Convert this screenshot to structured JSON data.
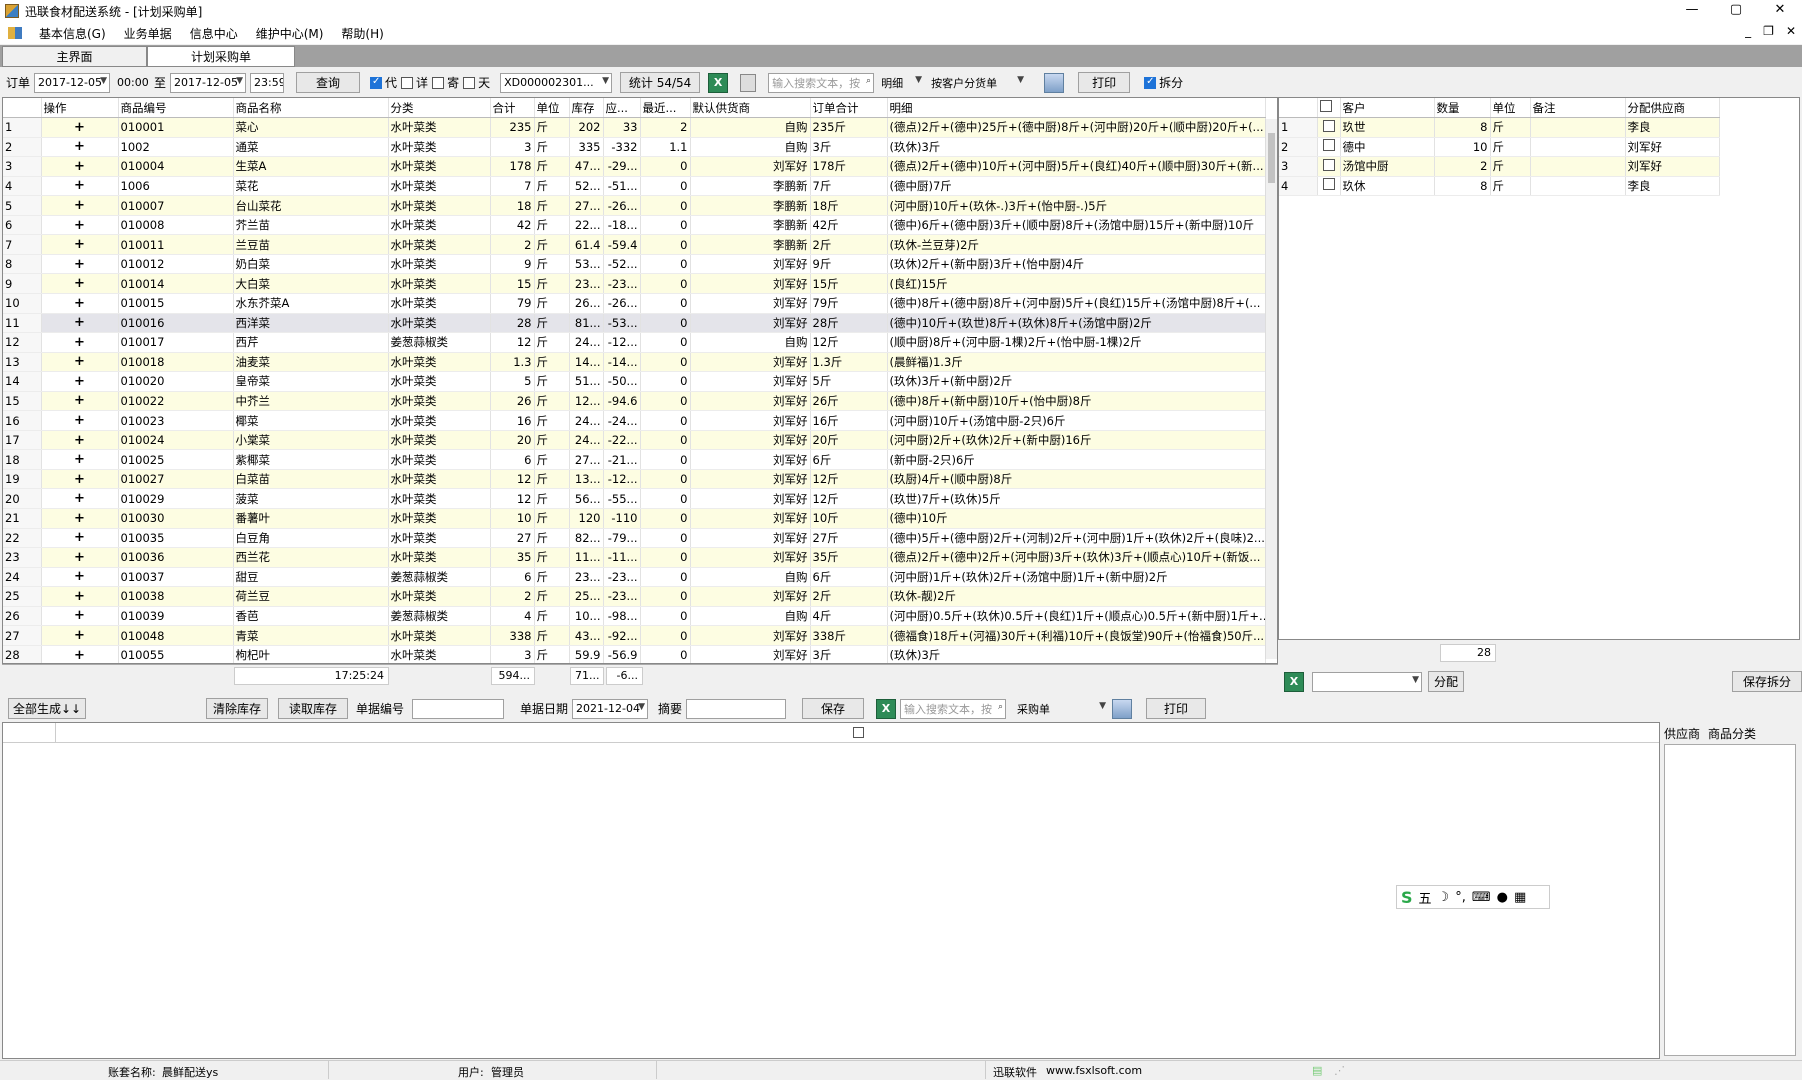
{
  "window": {
    "title": "迅联食材配送系统 - [计划采购单]",
    "min": "—",
    "max": "▢",
    "close": "✕"
  },
  "menu": [
    "基本信息(G)",
    "业务单据",
    "信息中心",
    "维护中心(M)",
    "帮助(H)"
  ],
  "tabs": [
    "主界面",
    "计划采购单"
  ],
  "toolbar": {
    "order_label": "订单",
    "date_from": "2017-12-05",
    "time_from": "00:00",
    "to_label": "至",
    "date_to": "2017-12-05",
    "time_to": "23:59",
    "query": "查询",
    "chk_dai": "代",
    "chk_xiang": "详",
    "chk_ji": "寄",
    "chk_tian": "天",
    "order_no": "XD000002301...",
    "stats": "统计 54/54",
    "search_placeholder": "输入搜索文本，按",
    "detail_select": "明细",
    "group_select": "按客户分货单",
    "print": "打印",
    "split": "拆分"
  },
  "main_table": {
    "headers": [
      "操作",
      "商品编号",
      "商品名称",
      "分类",
      "合计",
      "单位",
      "库存",
      "应...",
      "最近...",
      "默认供货商",
      "订单合计",
      "明细"
    ],
    "rows": [
      [
        "1",
        "+",
        "010001",
        "菜心",
        "水叶菜类",
        "235",
        "斤",
        "202",
        "33",
        "2",
        "自购",
        "235斤",
        "(德点)2斤+(德中)25斤+(德中厨)8斤+(河中厨)20斤+(顺中厨)20斤+(..."
      ],
      [
        "2",
        "+",
        "1002",
        "通菜",
        "水叶菜类",
        "3",
        "斤",
        "335",
        "-332",
        "1.1",
        "自购",
        "3斤",
        "(玖休)3斤"
      ],
      [
        "3",
        "+",
        "010004",
        "生菜A",
        "水叶菜类",
        "178",
        "斤",
        "47...",
        "-29...",
        "0",
        "刘军好",
        "178斤",
        "(德点)2斤+(德中)10斤+(河中厨)5斤+(良红)40斤+(顺中厨)30斤+(新..."
      ],
      [
        "4",
        "+",
        "1006",
        "菜花",
        "水叶菜类",
        "7",
        "斤",
        "52...",
        "-51...",
        "0",
        "李鹏新",
        "7斤",
        "(德中厨)7斤"
      ],
      [
        "5",
        "+",
        "010007",
        "台山菜花",
        "水叶菜类",
        "18",
        "斤",
        "27...",
        "-26...",
        "0",
        "李鹏新",
        "18斤",
        "(河中厨)10斤+(玖休-.)3斤+(怡中厨-.)5斤"
      ],
      [
        "6",
        "+",
        "010008",
        "芥兰苗",
        "水叶菜类",
        "42",
        "斤",
        "22...",
        "-18...",
        "0",
        "李鹏新",
        "42斤",
        "(德中)6斤+(德中厨)3斤+(顺中厨)8斤+(汤馆中厨)15斤+(新中厨)10斤"
      ],
      [
        "7",
        "+",
        "010011",
        "兰豆苗",
        "水叶菜类",
        "2",
        "斤",
        "61.4",
        "-59.4",
        "0",
        "李鹏新",
        "2斤",
        "(玖休-兰豆芽)2斤"
      ],
      [
        "8",
        "+",
        "010012",
        "奶白菜",
        "水叶菜类",
        "9",
        "斤",
        "53...",
        "-52...",
        "0",
        "刘军好",
        "9斤",
        "(玖休)2斤+(新中厨)3斤+(怡中厨)4斤"
      ],
      [
        "9",
        "+",
        "010014",
        "大白菜",
        "水叶菜类",
        "15",
        "斤",
        "23...",
        "-23...",
        "0",
        "刘军好",
        "15斤",
        "(良红)15斤"
      ],
      [
        "10",
        "+",
        "010015",
        "水东芥菜A",
        "水叶菜类",
        "79",
        "斤",
        "26...",
        "-26...",
        "0",
        "刘军好",
        "79斤",
        "(德中)8斤+(德中厨)8斤+(河中厨)5斤+(良红)15斤+(汤馆中厨)8斤+(..."
      ],
      [
        "11",
        "+",
        "010016",
        "西洋菜",
        "水叶菜类",
        "28",
        "斤",
        "81...",
        "-53...",
        "0",
        "刘军好",
        "28斤",
        "(德中)10斤+(玖世)8斤+(玖休)8斤+(汤馆中厨)2斤"
      ],
      [
        "12",
        "+",
        "010017",
        "西芹",
        "姜葱蒜椒类",
        "12",
        "斤",
        "24...",
        "-12...",
        "0",
        "自购",
        "12斤",
        "(顺中厨)8斤+(河中厨-1棵)2斤+(怡中厨-1棵)2斤"
      ],
      [
        "13",
        "+",
        "010018",
        "油麦菜",
        "水叶菜类",
        "1.3",
        "斤",
        "14...",
        "-14...",
        "0",
        "刘军好",
        "1.3斤",
        "(晨鲜福)1.3斤"
      ],
      [
        "14",
        "+",
        "010020",
        "皇帝菜",
        "水叶菜类",
        "5",
        "斤",
        "51...",
        "-50...",
        "0",
        "刘军好",
        "5斤",
        "(玖休)3斤+(新中厨)2斤"
      ],
      [
        "15",
        "+",
        "010022",
        "中芥兰",
        "水叶菜类",
        "26",
        "斤",
        "12...",
        "-94.6",
        "0",
        "刘军好",
        "26斤",
        "(德中)8斤+(新中厨)10斤+(怡中厨)8斤"
      ],
      [
        "16",
        "+",
        "010023",
        "椰菜",
        "水叶菜类",
        "16",
        "斤",
        "24...",
        "-24...",
        "0",
        "刘军好",
        "16斤",
        "(河中厨)10斤+(汤馆中厨-2只)6斤"
      ],
      [
        "17",
        "+",
        "010024",
        "小棠菜",
        "水叶菜类",
        "20",
        "斤",
        "24...",
        "-22...",
        "0",
        "刘军好",
        "20斤",
        "(河中厨)2斤+(玖休)2斤+(新中厨)16斤"
      ],
      [
        "18",
        "+",
        "010025",
        "紫椰菜",
        "水叶菜类",
        "6",
        "斤",
        "27...",
        "-21...",
        "0",
        "刘军好",
        "6斤",
        "(新中厨-2只)6斤"
      ],
      [
        "19",
        "+",
        "010027",
        "白菜苗",
        "水叶菜类",
        "12",
        "斤",
        "13...",
        "-12...",
        "0",
        "刘军好",
        "12斤",
        "(玖厨)4斤+(顺中厨)8斤"
      ],
      [
        "20",
        "+",
        "010029",
        "菠菜",
        "水叶菜类",
        "12",
        "斤",
        "56...",
        "-55...",
        "0",
        "刘军好",
        "12斤",
        "(玖世)7斤+(玖休)5斤"
      ],
      [
        "21",
        "+",
        "010030",
        "番薯叶",
        "水叶菜类",
        "10",
        "斤",
        "120",
        "-110",
        "0",
        "刘军好",
        "10斤",
        "(德中)10斤"
      ],
      [
        "22",
        "+",
        "010035",
        "白豆角",
        "水叶菜类",
        "27",
        "斤",
        "82...",
        "-79...",
        "0",
        "刘军好",
        "27斤",
        "(德中)5斤+(德中厨)2斤+(河制)2斤+(河中厨)1斤+(玖休)2斤+(良味)2..."
      ],
      [
        "23",
        "+",
        "010036",
        "西兰花",
        "水叶菜类",
        "35",
        "斤",
        "11...",
        "-11...",
        "0",
        "刘军好",
        "35斤",
        "(德点)2斤+(德中)2斤+(河中厨)3斤+(玖休)3斤+(顺点心)10斤+(新饭..."
      ],
      [
        "24",
        "+",
        "010037",
        "甜豆",
        "姜葱蒜椒类",
        "6",
        "斤",
        "23...",
        "-23...",
        "0",
        "自购",
        "6斤",
        "(河中厨)1斤+(玖休)2斤+(汤馆中厨)1斤+(新中厨)2斤"
      ],
      [
        "25",
        "+",
        "010038",
        "荷兰豆",
        "水叶菜类",
        "2",
        "斤",
        "25...",
        "-23...",
        "0",
        "刘军好",
        "2斤",
        "(玖休-靓)2斤"
      ],
      [
        "26",
        "+",
        "010039",
        "香芭",
        "姜葱蒜椒类",
        "4",
        "斤",
        "10...",
        "-98...",
        "0",
        "自购",
        "4斤",
        "(河中厨)0.5斤+(玖休)0.5斤+(良红)1斤+(顺点心)0.5斤+(新中厨)1斤+..."
      ],
      [
        "27",
        "+",
        "010048",
        "青菜",
        "水叶菜类",
        "338",
        "斤",
        "43...",
        "-92...",
        "0",
        "刘军好",
        "338斤",
        "(德福食)18斤+(河福)30斤+(利福)10斤+(良饭堂)90斤+(怡福食)50斤..."
      ],
      [
        "28",
        "+",
        "010055",
        "枸杞叶",
        "水叶菜类",
        "3",
        "斤",
        "59.9",
        "-56.9",
        "0",
        "刘军好",
        "3斤",
        "(玖休)3斤"
      ]
    ],
    "sum_time": "17:25:24",
    "sum_total": "594...",
    "sum_stock": "71...",
    "sum_need": "-6..."
  },
  "right_table": {
    "headers": [
      "客户",
      "数量",
      "单位",
      "备注",
      "分配供应商"
    ],
    "rows": [
      [
        "1",
        "玖世",
        "8",
        "斤",
        "",
        "李良"
      ],
      [
        "2",
        "德中",
        "10",
        "斤",
        "",
        "刘军好"
      ],
      [
        "3",
        "汤馆中厨",
        "2",
        "斤",
        "",
        "刘军好"
      ],
      [
        "4",
        "玖休",
        "8",
        "斤",
        "",
        "李良"
      ]
    ],
    "sum": "28",
    "assign": "分配",
    "save_split": "保存拆分"
  },
  "bottom_toolbar": {
    "gen_all": "全部生成↓↓",
    "clear_stock": "清除库存",
    "read_stock": "读取库存",
    "doc_no_label": "单据编号",
    "doc_date_label": "单据日期",
    "doc_date": "2021-12-04",
    "summary_label": "摘要",
    "save": "保存",
    "search_placeholder": "输入搜索文本，按",
    "type_select": "采购单",
    "print": "打印"
  },
  "side_tabs": [
    "供应商",
    "商品分类"
  ],
  "ime": {
    "logo": "S",
    "mode": "五"
  },
  "status": {
    "account_label": "账套名称:",
    "account": "晨鲜配送ys",
    "user_label": "用户:",
    "user": "管理员",
    "company": "迅联软件",
    "website": "www.fsxlsoft.com"
  }
}
